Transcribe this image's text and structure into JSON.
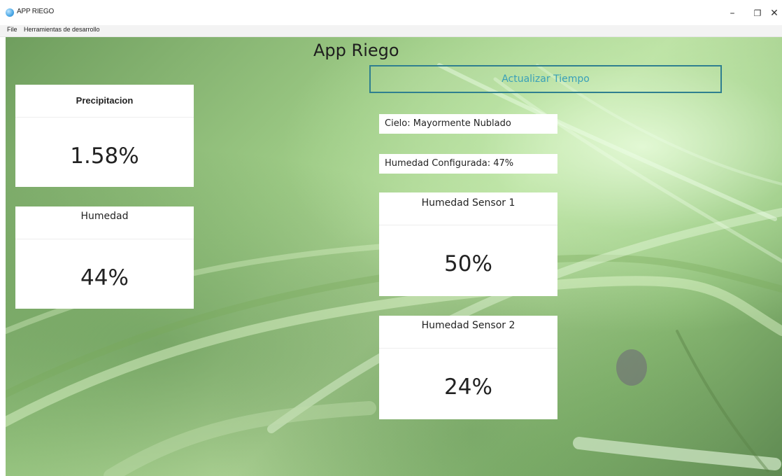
{
  "window": {
    "title": "APP RIEGO",
    "controls": [
      "–",
      "❐",
      "✕"
    ]
  },
  "menu": {
    "items": [
      "File",
      "Herramientas de desarrollo"
    ]
  },
  "app": {
    "title": "App Riego",
    "update_button": "Actualizar Tiempo"
  },
  "cards": {
    "precipitacion": {
      "label": "Precipitacion",
      "value": "1.58%"
    },
    "humedad": {
      "label": "Humedad",
      "value": "44%"
    },
    "sensor1": {
      "label": "Humedad Sensor 1",
      "value": "50%"
    },
    "sensor2": {
      "label": "Humedad Sensor 2",
      "value": "24%"
    }
  },
  "info": {
    "cielo": "Cielo: Mayormente Nublado",
    "humedad_configurada": "Humedad Configurada: 47%"
  }
}
